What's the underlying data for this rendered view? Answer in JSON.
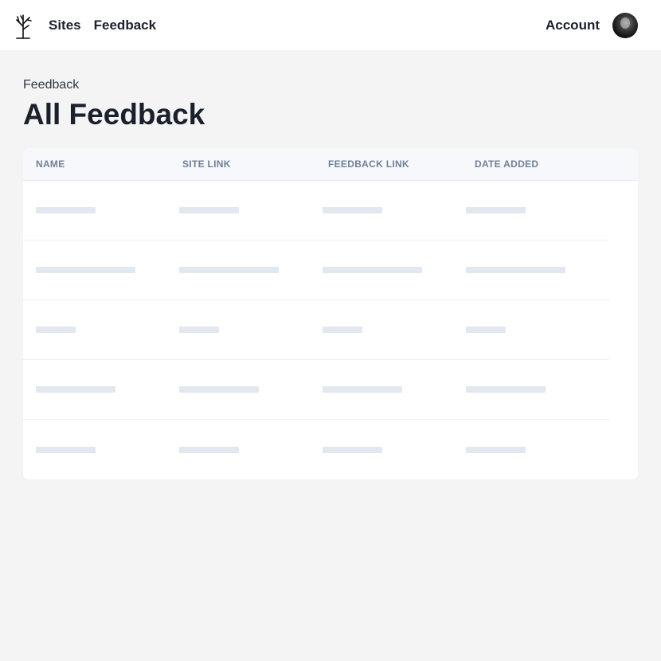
{
  "header": {
    "logo": "tree-logo",
    "nav": [
      {
        "label": "Sites"
      },
      {
        "label": "Feedback"
      }
    ],
    "account_label": "Account"
  },
  "page": {
    "breadcrumb": "Feedback",
    "title": "All Feedback"
  },
  "table": {
    "columns": [
      "Name",
      "Site Link",
      "Feedback Link",
      "Date Added"
    ],
    "loading_state": true,
    "skeleton_row_count": 5,
    "skeleton_color": "#e2e8f0"
  },
  "colors": {
    "background": "#f4f4f4",
    "header_bg": "#ffffff",
    "card_bg": "#ffffff",
    "table_header_bg": "#f6f8fb",
    "heading_text": "#1a202c",
    "column_header_text": "#718096"
  }
}
